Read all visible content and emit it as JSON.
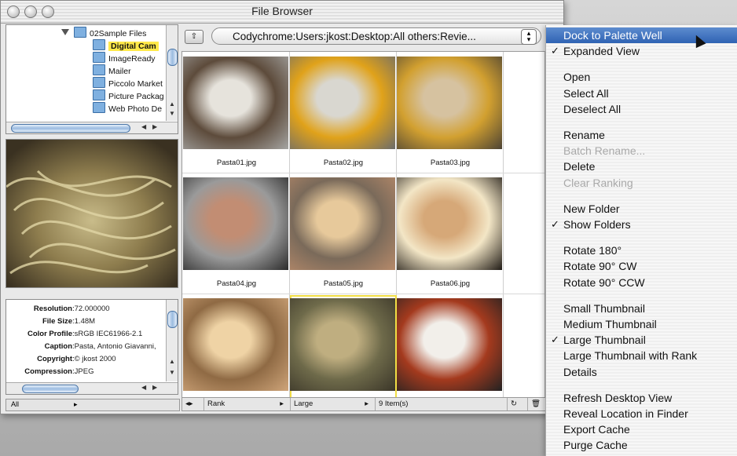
{
  "window": {
    "title": "File Browser"
  },
  "folders": {
    "items": [
      {
        "label": "02Sample Files",
        "level": 0,
        "expanded": true
      },
      {
        "label": "Digital Cam",
        "level": 1,
        "selected": true
      },
      {
        "label": "ImageReady",
        "level": 1
      },
      {
        "label": "Mailer",
        "level": 1
      },
      {
        "label": "Piccolo Market",
        "level": 1
      },
      {
        "label": "Picture Packag",
        "level": 1
      },
      {
        "label": "Web Photo De",
        "level": 1
      }
    ]
  },
  "metadata": {
    "rows": [
      {
        "key": "Resolution",
        "value": "72.000000"
      },
      {
        "key": "File Size",
        "value": "1.48M"
      },
      {
        "key": "Color Profile",
        "value": "sRGB IEC61966-2.1"
      },
      {
        "key": "Caption",
        "value": "Pasta, Antonio Giavanni,"
      },
      {
        "key": "Copyright",
        "value": "© jkost 2000"
      },
      {
        "key": "Compression",
        "value": "JPEG"
      }
    ]
  },
  "left_footer": {
    "selector": "All",
    "arrow": "▸"
  },
  "path": {
    "value": "Codychrome:Users:jkost:Desktop:All others:Revie..."
  },
  "thumbnails": [
    {
      "name": "Pasta01.jpg",
      "colors": [
        "#a5a5a3",
        "#e6e3dc",
        "#5d4b3b"
      ]
    },
    {
      "name": "Pasta02.jpg",
      "colors": [
        "#6b6b6b",
        "#d9d7d0",
        "#e0a21a"
      ]
    },
    {
      "name": "Pasta03.jpg",
      "colors": [
        "#4c4334",
        "#d6c2a0",
        "#d2a030"
      ]
    },
    {
      "name": "Pasta04.jpg",
      "colors": [
        "#2b2b2b",
        "#c28d73",
        "#9a9a9a"
      ]
    },
    {
      "name": "Pasta05.jpg",
      "colors": [
        "#b78a6a",
        "#e7c99b",
        "#7a6a5a"
      ]
    },
    {
      "name": "Pasta06.jpg",
      "colors": [
        "#1f1a15",
        "#d6a878",
        "#f3e6c6"
      ]
    },
    {
      "name": "",
      "colors": [
        "#cfa57a",
        "#efd3a5",
        "#8f6a44"
      ]
    },
    {
      "name": "",
      "colors": [
        "#3a3528",
        "#bfae80",
        "#6e6a4a"
      ]
    },
    {
      "name": "",
      "colors": [
        "#222222",
        "#f2efea",
        "#a43a1e"
      ]
    }
  ],
  "statusbar": {
    "sort": "Rank",
    "size": "Large",
    "count": "9 Item(s)"
  },
  "menu": {
    "items": [
      {
        "label": "Dock to Palette Well",
        "highlighted": true
      },
      {
        "label": "Expanded View",
        "checked": true
      },
      {
        "separator": true
      },
      {
        "label": "Open"
      },
      {
        "label": "Select All"
      },
      {
        "label": "Deselect All"
      },
      {
        "separator": true
      },
      {
        "label": "Rename"
      },
      {
        "label": "Batch Rename...",
        "disabled": true
      },
      {
        "label": "Delete"
      },
      {
        "label": "Clear Ranking",
        "disabled": true
      },
      {
        "separator": true
      },
      {
        "label": "New Folder"
      },
      {
        "label": "Show Folders",
        "checked": true
      },
      {
        "separator": true
      },
      {
        "label": "Rotate 180°"
      },
      {
        "label": "Rotate 90° CW"
      },
      {
        "label": "Rotate 90° CCW"
      },
      {
        "separator": true
      },
      {
        "label": "Small Thumbnail"
      },
      {
        "label": "Medium Thumbnail"
      },
      {
        "label": "Large Thumbnail",
        "checked": true
      },
      {
        "label": "Large Thumbnail with Rank"
      },
      {
        "label": "Details"
      },
      {
        "separator": true
      },
      {
        "label": "Refresh Desktop View"
      },
      {
        "label": "Reveal Location in Finder"
      },
      {
        "label": "Export Cache"
      },
      {
        "label": "Purge Cache"
      }
    ]
  }
}
